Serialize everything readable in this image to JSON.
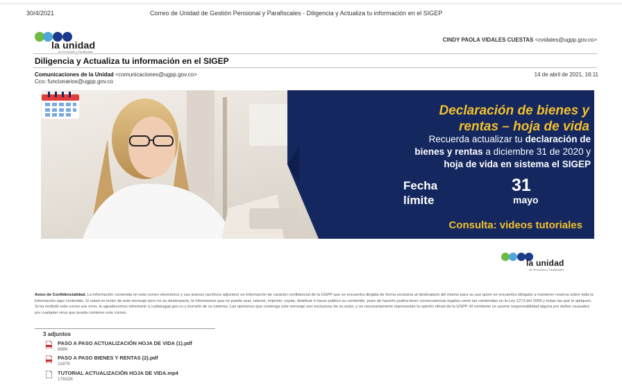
{
  "print_header": {
    "date": "30/4/2021",
    "title": "Correo de Unidad de Gestión Pensional y Parafiscales - Diligencia y Actualiza tu información en el SIGEP"
  },
  "logo": {
    "text": "la unidad",
    "sub": "de Pensiones y Parafiscales",
    "colors": [
      "#6dbb3f",
      "#4fa6d9",
      "#1b3b8a"
    ]
  },
  "account": {
    "name": "CINDY PAOLA VIDALES CUESTAS",
    "email": "<cvidales@ugpp.gov.co>"
  },
  "email": {
    "subject": "Diligencia y Actualiza tu información en el SIGEP",
    "from_name": "Comunicaciones de la Unidad",
    "from_email": "<comunicaciones@ugpp.gov.co>",
    "cc": "Cco: funcionarios@ugpp.gov.co",
    "date": "14 de abril de 2021, 16:11"
  },
  "banner": {
    "title_line1": "Declaración de bienes y",
    "title_line2": "rentas – hoja de vida",
    "text_pre": "Recuerda actualizar tu ",
    "text_bold1": "declaración de",
    "text_bold2": "bienes y rentas",
    "text_mid": " a diciembre 31 de 2020 y",
    "text_line3": "hoja de vida en sistema el SIGEP",
    "fecha_line1": "Fecha",
    "fecha_line2": "límite",
    "day": "31",
    "month": "mayo",
    "consulta": "Consulta: videos tutoriales",
    "colors": {
      "navy": "#14275f",
      "yellow": "#f2c12e"
    }
  },
  "footer_logo": {
    "text": "la unidad",
    "sub": "de Pensiones y Parafiscales"
  },
  "confidentiality": {
    "label": "Aviso de Confidencialidad.",
    "text": "La información contenida en este correo electrónico y sus anexos (archivos adjuntos) es información de carácter confidencial de la UGPP que se encuentra dirigida de forma exclusiva al destinatario del mismo para su uso quien se encuentra obligado a mantener reserva sobre toda la información aquí contenida. Si usted es lector de este mensaje pero no su destinatario, le informamos que no puede usar, retener, imprimir, copiar, distribuir o hacer público su contenido, pues de hacerlo podría tener consecuencias legales como las contenidas en la Ley 1273 del 2009 y todas las que le apliquen. Si ha recibido este correo por error, le agradecemos informarlo a cuidatugpp.gov.co y borrarlo de su sistema. Las opiniones que contenga este mensaje son exclusivas de su autor, y no necesariamente representan la opinión oficial de la UGPP. El remitente no asume responsabilidad alguna por daños causados por cualquier virus que pueda contener este correo."
  },
  "attachments": {
    "header": "3 adjuntos",
    "items": [
      {
        "name": "PASO A PASO ACTUALIZACIÓN HOJA DE VIDA (1).pdf",
        "size": "888K",
        "type": "pdf"
      },
      {
        "name": "PASO A PASO  BIENES Y RENTAS (2).pdf",
        "size": "1187K",
        "type": "pdf"
      },
      {
        "name": "TUTORIAL ACTUALIZACIÓN HOJA DE VIDA.mp4",
        "size": "17632K",
        "type": "video"
      }
    ]
  }
}
